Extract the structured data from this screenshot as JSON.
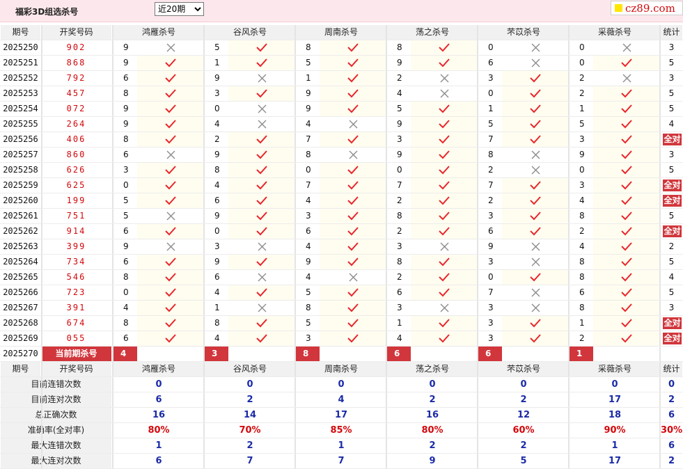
{
  "top": {
    "title": "福彩3D组选杀号",
    "select_value": "近20期",
    "logo_text": "cz89.com"
  },
  "header": {
    "period": "期号",
    "draw": "开奖号码",
    "stat": "统计",
    "methods": [
      "鸿雁杀号",
      "谷风杀号",
      "周南杀号",
      "荡之杀号",
      "芣苡杀号",
      "采薇杀号"
    ]
  },
  "rows": [
    {
      "period": "2025250",
      "draw": "902",
      "kills": [
        9,
        5,
        8,
        8,
        0,
        0
      ],
      "hits": [
        0,
        1,
        1,
        1,
        0,
        0
      ],
      "stat": "3"
    },
    {
      "period": "2025251",
      "draw": "868",
      "kills": [
        9,
        1,
        5,
        9,
        6,
        0
      ],
      "hits": [
        1,
        1,
        1,
        1,
        0,
        1
      ],
      "stat": "5"
    },
    {
      "period": "2025252",
      "draw": "792",
      "kills": [
        6,
        9,
        1,
        2,
        3,
        2
      ],
      "hits": [
        1,
        0,
        1,
        0,
        1,
        0
      ],
      "stat": "3"
    },
    {
      "period": "2025253",
      "draw": "457",
      "kills": [
        8,
        3,
        9,
        4,
        0,
        2
      ],
      "hits": [
        1,
        1,
        1,
        0,
        1,
        1
      ],
      "stat": "5"
    },
    {
      "period": "2025254",
      "draw": "072",
      "kills": [
        9,
        0,
        9,
        5,
        1,
        1
      ],
      "hits": [
        1,
        0,
        1,
        1,
        1,
        1
      ],
      "stat": "5"
    },
    {
      "period": "2025255",
      "draw": "264",
      "kills": [
        9,
        4,
        4,
        9,
        5,
        5
      ],
      "hits": [
        1,
        0,
        0,
        1,
        1,
        1
      ],
      "stat": "4"
    },
    {
      "period": "2025256",
      "draw": "406",
      "kills": [
        8,
        2,
        7,
        3,
        7,
        3
      ],
      "hits": [
        1,
        1,
        1,
        1,
        1,
        1
      ],
      "stat": "全对"
    },
    {
      "period": "2025257",
      "draw": "860",
      "kills": [
        6,
        9,
        8,
        9,
        8,
        9
      ],
      "hits": [
        0,
        1,
        0,
        1,
        0,
        1
      ],
      "stat": "3"
    },
    {
      "period": "2025258",
      "draw": "626",
      "kills": [
        3,
        8,
        0,
        0,
        2,
        0
      ],
      "hits": [
        1,
        1,
        1,
        1,
        0,
        1
      ],
      "stat": "5"
    },
    {
      "period": "2025259",
      "draw": "625",
      "kills": [
        0,
        4,
        7,
        7,
        7,
        3
      ],
      "hits": [
        1,
        1,
        1,
        1,
        1,
        1
      ],
      "stat": "全对"
    },
    {
      "period": "2025260",
      "draw": "199",
      "kills": [
        5,
        6,
        4,
        2,
        2,
        4
      ],
      "hits": [
        1,
        1,
        1,
        1,
        1,
        1
      ],
      "stat": "全对"
    },
    {
      "period": "2025261",
      "draw": "751",
      "kills": [
        5,
        9,
        3,
        8,
        3,
        8
      ],
      "hits": [
        0,
        1,
        1,
        1,
        1,
        1
      ],
      "stat": "5"
    },
    {
      "period": "2025262",
      "draw": "914",
      "kills": [
        6,
        0,
        6,
        2,
        6,
        2
      ],
      "hits": [
        1,
        1,
        1,
        1,
        1,
        1
      ],
      "stat": "全对"
    },
    {
      "period": "2025263",
      "draw": "399",
      "kills": [
        9,
        3,
        4,
        3,
        9,
        4
      ],
      "hits": [
        0,
        0,
        1,
        0,
        0,
        1
      ],
      "stat": "2"
    },
    {
      "period": "2025264",
      "draw": "734",
      "kills": [
        6,
        9,
        9,
        8,
        3,
        8
      ],
      "hits": [
        1,
        1,
        1,
        1,
        0,
        1
      ],
      "stat": "5"
    },
    {
      "period": "2025265",
      "draw": "546",
      "kills": [
        8,
        6,
        4,
        2,
        0,
        8
      ],
      "hits": [
        1,
        0,
        0,
        1,
        1,
        1
      ],
      "stat": "4"
    },
    {
      "period": "2025266",
      "draw": "723",
      "kills": [
        0,
        4,
        5,
        6,
        7,
        6
      ],
      "hits": [
        1,
        1,
        1,
        1,
        0,
        1
      ],
      "stat": "5"
    },
    {
      "period": "2025267",
      "draw": "391",
      "kills": [
        4,
        1,
        8,
        3,
        3,
        8
      ],
      "hits": [
        1,
        0,
        1,
        0,
        0,
        1
      ],
      "stat": "3"
    },
    {
      "period": "2025268",
      "draw": "674",
      "kills": [
        8,
        8,
        5,
        1,
        3,
        1
      ],
      "hits": [
        1,
        1,
        1,
        1,
        1,
        1
      ],
      "stat": "全对"
    },
    {
      "period": "2025269",
      "draw": "055",
      "kills": [
        6,
        4,
        3,
        4,
        3,
        2
      ],
      "hits": [
        1,
        1,
        1,
        1,
        1,
        1
      ],
      "stat": "全对"
    }
  ],
  "current": {
    "period": "2025270",
    "label": "当前期杀号",
    "kills": [
      "4",
      "3",
      "8",
      "6",
      "6",
      "1"
    ]
  },
  "summary": [
    {
      "label": "目前连错次数",
      "values": [
        "0",
        "0",
        "0",
        "0",
        "0",
        "0"
      ],
      "stat": "0",
      "red": false
    },
    {
      "label": "目前连对次数",
      "values": [
        "6",
        "2",
        "4",
        "2",
        "2",
        "17"
      ],
      "stat": "2",
      "red": false
    },
    {
      "label": "总正确次数",
      "values": [
        "16",
        "14",
        "17",
        "16",
        "12",
        "18"
      ],
      "stat": "6",
      "red": false
    },
    {
      "label": "准确率(全对率)",
      "values": [
        "80%",
        "70%",
        "85%",
        "80%",
        "60%",
        "90%"
      ],
      "stat": "30%",
      "red": true
    },
    {
      "label": "最大连错次数",
      "values": [
        "1",
        "2",
        "1",
        "2",
        "2",
        "1"
      ],
      "stat": "6",
      "red": false
    },
    {
      "label": "最大连对次数",
      "values": [
        "6",
        "7",
        "7",
        "9",
        "5",
        "17"
      ],
      "stat": "2",
      "red": false
    }
  ],
  "colors": {
    "check": "#e8262b",
    "cross": "#8c8c8c",
    "accent": "#d1363c",
    "stat_blue": "#1a2aa7"
  },
  "icons": {
    "hit": "check-icon",
    "miss": "cross-icon"
  }
}
